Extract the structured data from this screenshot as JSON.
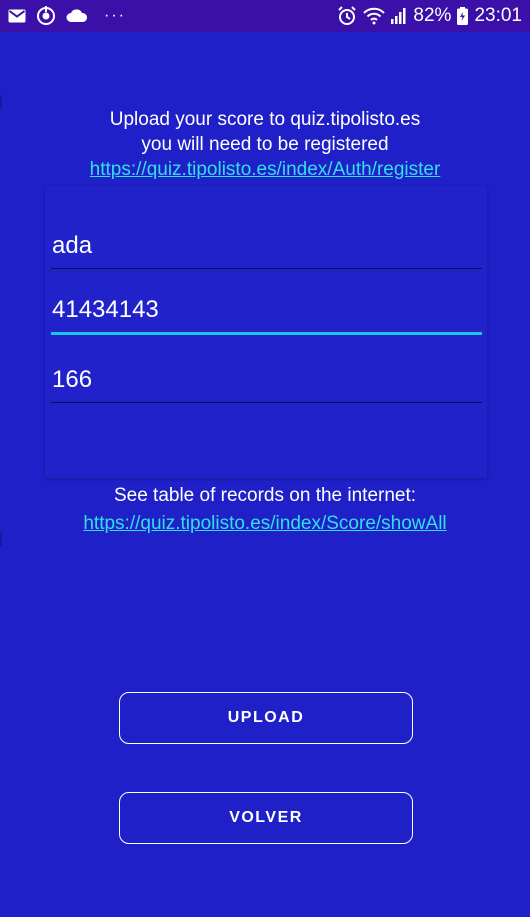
{
  "status_bar": {
    "icons_left": [
      "mail-icon",
      "sync-icon",
      "cloud-icon"
    ],
    "dots": "···",
    "icons_right": [
      "alarm-icon",
      "wifi-icon",
      "signal-icon",
      "battery-icon"
    ],
    "battery": "82%",
    "time": "23:01"
  },
  "intro": {
    "line1": "Upload your score to quiz.tipolisto.es",
    "line2": "you will need to be registered",
    "register_link": "https://quiz.tipolisto.es/index/Auth/register"
  },
  "form": {
    "name_value": "ada",
    "password_value": "41434143",
    "score_value": "166"
  },
  "records": {
    "text": "See table of records on the internet:",
    "link": "https://quiz.tipolisto.es/index/Score/showAll"
  },
  "buttons": {
    "upload": "UPLOAD",
    "volver": "VOLVER"
  },
  "colors": {
    "background": "#2020c8",
    "status_bar": "#3a10a8",
    "link": "#30e0e8",
    "focus_underline": "#18c8e6"
  }
}
